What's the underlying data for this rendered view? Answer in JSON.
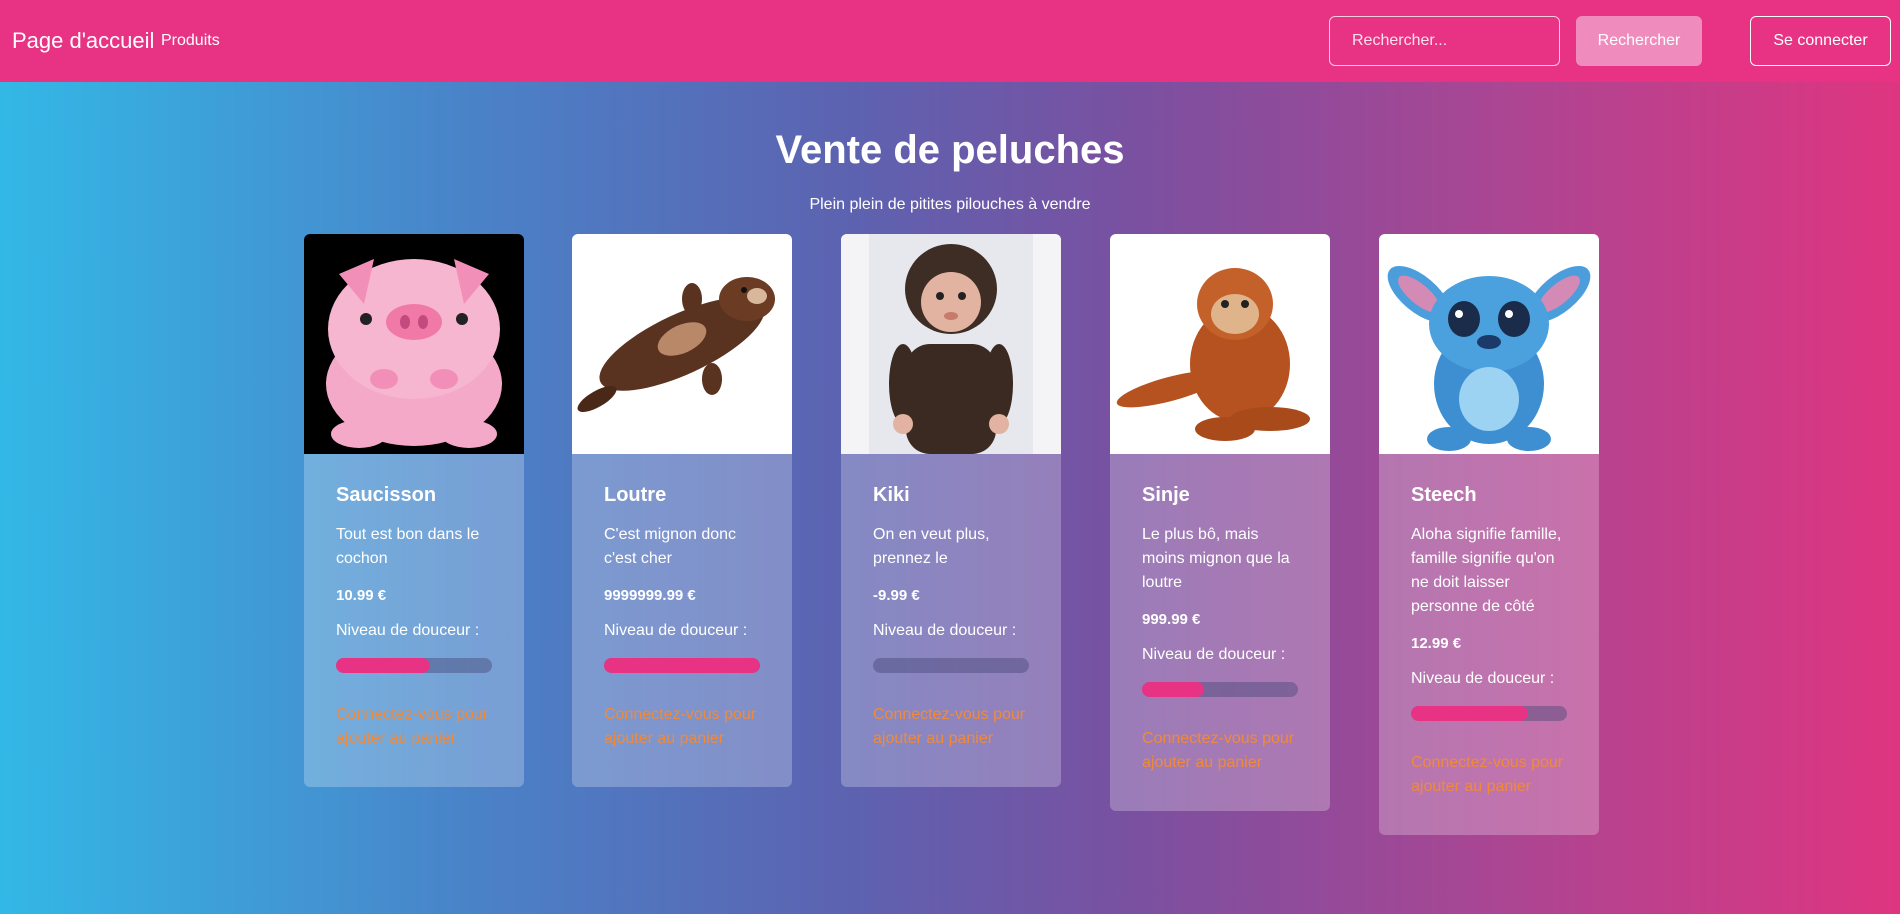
{
  "navbar": {
    "brand": "Page d'accueil",
    "products_link": "Produits",
    "search_placeholder": "Rechercher...",
    "search_button": "Rechercher",
    "login_button": "Se connecter",
    "background_color": "#e83384"
  },
  "hero": {
    "title": "Vente de peluches",
    "subtitle": "Plein plein de pitites pilouches à vendre"
  },
  "products": [
    {
      "name": "Saucisson",
      "description": "Tout est bon dans le cochon",
      "price": "10.99 €",
      "softness_label": "Niveau de douceur :",
      "softness_fraction": 0.6,
      "login_link": "Connectez-vous pour ajouter au panier",
      "image_icon": "pink-pig-plush"
    },
    {
      "name": "Loutre",
      "description": "C'est mignon donc c'est cher",
      "price": "9999999.99 €",
      "softness_label": "Niveau de douceur :",
      "softness_fraction": 1.0,
      "login_link": "Connectez-vous pour ajouter au panier",
      "image_icon": "otter-plush"
    },
    {
      "name": "Kiki",
      "description": "On en veut plus, prennez le",
      "price": "-9.99 €",
      "softness_label": "Niveau de douceur :",
      "softness_fraction": 0.0,
      "login_link": "Connectez-vous pour ajouter au panier",
      "image_icon": "monkey-doll"
    },
    {
      "name": "Sinje",
      "description": "Le plus bô, mais moins mignon que la loutre",
      "price": "999.99 €",
      "softness_label": "Niveau de douceur :",
      "softness_fraction": 0.4,
      "login_link": "Connectez-vous pour ajouter au panier",
      "image_icon": "orangutan-plush"
    },
    {
      "name": "Steech",
      "description": "Aloha signifie famille, famille signifie qu'on ne doit laisser personne de côté",
      "price": "12.99 €",
      "softness_label": "Niveau de douceur :",
      "softness_fraction": 0.75,
      "login_link": "Connectez-vous pour ajouter au panier",
      "image_icon": "blue-alien-plush"
    }
  ]
}
